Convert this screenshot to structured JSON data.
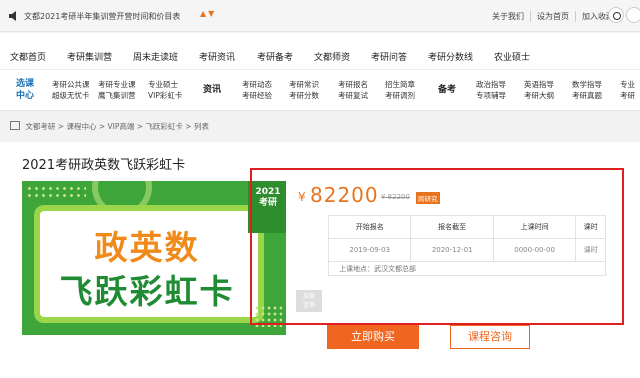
{
  "topbar": {
    "notice": "文都2021考研半年集训营开营时间和价目表",
    "arrows": "▲▼",
    "links": [
      "关于我们",
      "设为首页",
      "加入收藏"
    ]
  },
  "mainnav": [
    "文都首页",
    "考研集训营",
    "周末走读班",
    "考研资讯",
    "考研备考",
    "文都师资",
    "考研问答",
    "考研分数线",
    "农业硕士"
  ],
  "catbar": {
    "select_center": [
      "选课",
      "中心"
    ],
    "course_groups": [
      [
        "考研公共课",
        "超级无忧卡"
      ],
      [
        "考研专业课",
        "鹰飞集训营"
      ],
      [
        "专业硕士",
        "VIP彩虹卡"
      ]
    ],
    "news_label": "资讯",
    "news_groups": [
      [
        "考研动态",
        "考研经验"
      ],
      [
        "考研常识",
        "考研分数"
      ],
      [
        "考研报名",
        "考研复试"
      ],
      [
        "招生简章",
        "考研调剂"
      ]
    ],
    "prep_label": "备考",
    "prep_groups": [
      [
        "政治指导",
        "专项辅导"
      ],
      [
        "英语指导",
        "考研大纲"
      ],
      [
        "数学指导",
        "考研真题"
      ],
      [
        "专业",
        "考研"
      ]
    ]
  },
  "breadcrumb": "文都考研 > 课程中心 > VIP高端 > 飞跃彩虹卡 > 列表",
  "course": {
    "title": "2021考研政英数飞跃彩虹卡",
    "image": {
      "year": "2021",
      "year_sub": "考研",
      "line1": "政英数",
      "line2": "飞跃彩虹卡"
    },
    "side_tag": "加微\n咨询",
    "currency": "¥",
    "price": "82200",
    "old_price": "¥ 82200",
    "badge": "跨研究",
    "table": {
      "headers": [
        "开始报名",
        "报名截至",
        "上课时间",
        "课时"
      ],
      "row": [
        "2019-09-03",
        "2020-12-01",
        "0000-00-00",
        "课时"
      ],
      "address": "上课地点：武汉文都总部"
    },
    "buy_label": "立即购买",
    "consult_label": "课程咨询"
  },
  "colors": {
    "accent": "#f0651f",
    "annotation": "#e02020",
    "card_green": "#3da53a"
  }
}
